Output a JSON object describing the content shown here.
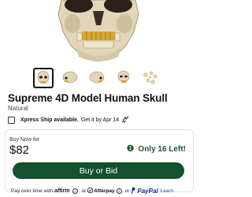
{
  "product": {
    "title": "Supreme 4D Model Human Skull",
    "brand": "Natural",
    "thumbnail_count": 5,
    "active_thumbnail": 1
  },
  "shipping": {
    "xpress_label": "Xpress Ship available.",
    "date_text": "Get it by Apr 14",
    "checked": false
  },
  "buy_box": {
    "label": "Buy Now for",
    "price": "$82",
    "stock_text": "Only 16 Left!",
    "button_label": "Buy or Bid"
  },
  "pay_later": {
    "prefix": "Pay over time with",
    "affirm": "affirm",
    "or_1": "or",
    "afterpay": "Afterpay",
    "or_2": "or",
    "paypal": "PayPal",
    "learn": "Learn"
  },
  "colors": {
    "accent_green": "#14512e",
    "stock_green": "#1e5631",
    "bone": "#e2d6b8",
    "gold_teeth": "#d8a830",
    "link_blue": "#1a4fd0"
  }
}
